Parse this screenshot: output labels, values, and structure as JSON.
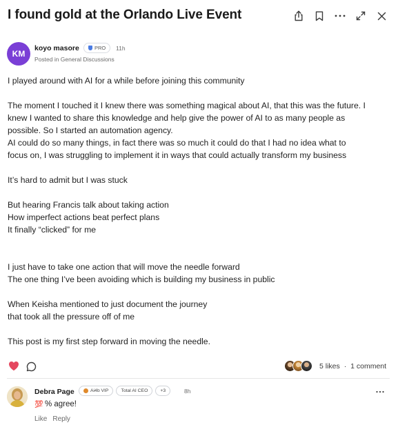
{
  "header": {
    "title": "I found gold at the Orlando Live Event",
    "icons": [
      "share-icon",
      "bookmark-icon",
      "more-icon",
      "expand-icon",
      "close-icon"
    ]
  },
  "author": {
    "initials": "KM",
    "avatar_color": "#7a3fd6",
    "name": "koyo masore",
    "badge": "PRO",
    "time": "11h",
    "posted_in": "Posted in General Discussions"
  },
  "post": {
    "lines": [
      "I played around with AI for a while before joining this community",
      "",
      "The moment I touched it I knew there was something magical about AI, that this was the future. I",
      "knew I wanted to share this knowledge and help give the power of AI to as many people as",
      "possible. So I started an automation agency.",
      "AI could do so many things, in fact there was so much it could do that I had no idea what to",
      "focus on, I was struggling to implement it in ways that could actually transform my business",
      "",
      "It’s hard to admit but I was stuck",
      "",
      "But hearing Francis talk about taking action",
      "How imperfect actions beat perfect plans",
      "It finally “clicked” for me",
      "",
      "",
      "I just have to take one action that will move the needle forward",
      "The one thing I’ve been avoiding which is building my business in public",
      "",
      "When Keisha mentioned to just document the journey",
      "that took all the pressure off of me",
      "",
      "This post is my first step forward in moving the needle."
    ]
  },
  "reactions": {
    "likes": "5 likes",
    "separator": "·",
    "comments": "1 comment",
    "heart_color": "#e5475f"
  },
  "comment": {
    "name": "Debra Page",
    "badges": [
      "Ai4b VIP",
      "Total AI CEO",
      "+3"
    ],
    "time": "8h",
    "text": "% agree!",
    "emoji": "💯",
    "like_label": "Like",
    "reply_label": "Reply"
  }
}
